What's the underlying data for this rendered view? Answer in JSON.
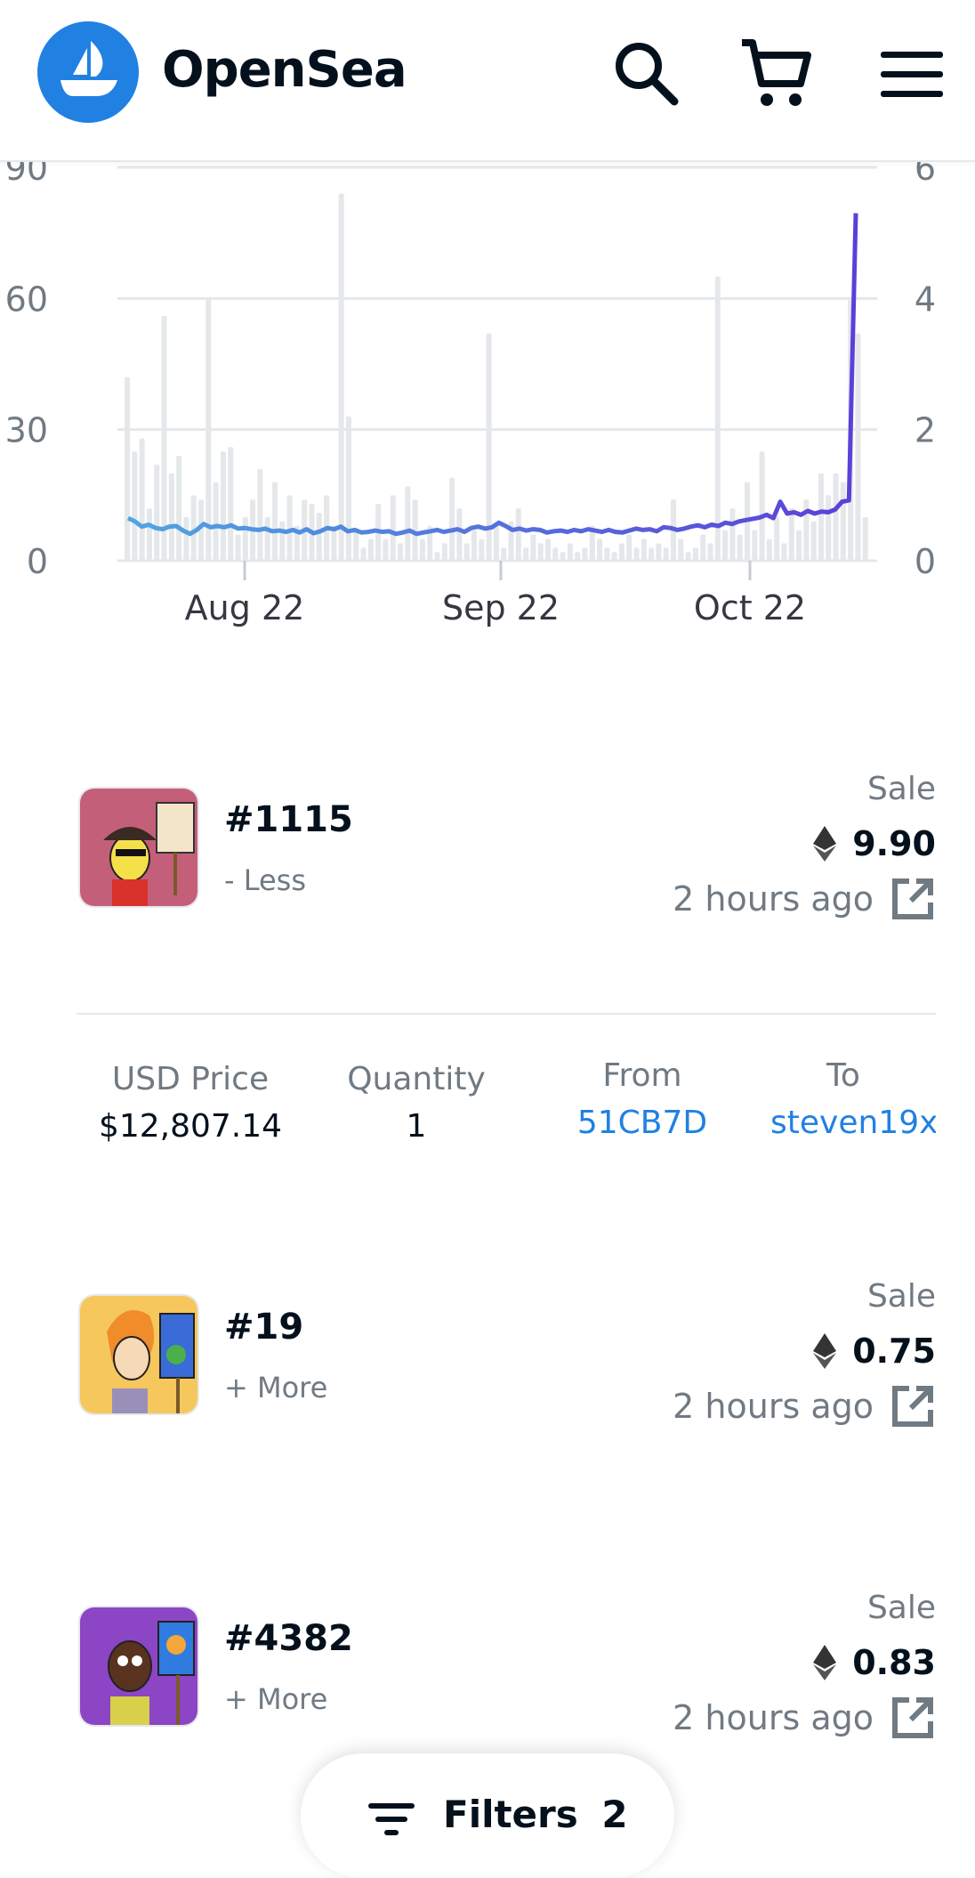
{
  "header": {
    "brand": "OpenSea",
    "icons": [
      "opensea-logo-icon",
      "search-icon",
      "cart-icon",
      "menu-icon"
    ]
  },
  "chart_data": {
    "type": "bar",
    "title": "",
    "x_ticks": [
      "Aug 22",
      "Sep 22",
      "Oct 22"
    ],
    "left_axis": {
      "ticks": [
        "0",
        "30",
        "60",
        "90"
      ],
      "ylim": [
        0,
        90
      ]
    },
    "right_axis": {
      "ticks": [
        "0",
        "2",
        "4",
        "6"
      ],
      "ylim": [
        0,
        6
      ]
    },
    "grid": true,
    "series": [
      {
        "kind": "bar",
        "axis": "left",
        "color": "#e5e8eb",
        "values": [
          42,
          25,
          28,
          12,
          22,
          56,
          20,
          24,
          10,
          15,
          14,
          60,
          18,
          25,
          26,
          6,
          10,
          14,
          21,
          10,
          18,
          9,
          15,
          8,
          14,
          13,
          11,
          15,
          8,
          84,
          33,
          7,
          3,
          5,
          13,
          5,
          15,
          4,
          17,
          14,
          5,
          8,
          2,
          4,
          19,
          12,
          4,
          7,
          5,
          52,
          8,
          3,
          9,
          12,
          3,
          6,
          4,
          5,
          3,
          2,
          4,
          2,
          3,
          8,
          5,
          3,
          2,
          4,
          6,
          3,
          5,
          3,
          4,
          3,
          14,
          5,
          2,
          3,
          6,
          4,
          65,
          7,
          12,
          6,
          18,
          7,
          25,
          5,
          10,
          4,
          12,
          7,
          14,
          9,
          20,
          15,
          20,
          18,
          60,
          52,
          10
        ]
      },
      {
        "kind": "line",
        "axis": "right",
        "color_start": "#4fa6e0",
        "color_end": "#5b3fd9",
        "values": [
          0.65,
          0.6,
          0.52,
          0.55,
          0.5,
          0.48,
          0.52,
          0.53,
          0.46,
          0.41,
          0.47,
          0.56,
          0.51,
          0.53,
          0.51,
          0.54,
          0.49,
          0.5,
          0.48,
          0.47,
          0.49,
          0.45,
          0.46,
          0.44,
          0.47,
          0.43,
          0.48,
          0.42,
          0.45,
          0.5,
          0.48,
          0.52,
          0.45,
          0.47,
          0.43,
          0.44,
          0.46,
          0.44,
          0.45,
          0.41,
          0.43,
          0.46,
          0.41,
          0.43,
          0.45,
          0.47,
          0.44,
          0.46,
          0.48,
          0.44,
          0.5,
          0.52,
          0.49,
          0.51,
          0.58,
          0.53,
          0.47,
          0.49,
          0.46,
          0.48,
          0.47,
          0.43,
          0.45,
          0.46,
          0.44,
          0.47,
          0.45,
          0.48,
          0.46,
          0.44,
          0.47,
          0.44,
          0.43,
          0.46,
          0.49,
          0.47,
          0.48,
          0.45,
          0.51,
          0.5,
          0.47,
          0.49,
          0.52,
          0.54,
          0.51,
          0.55,
          0.53,
          0.58,
          0.56,
          0.6,
          0.62,
          0.64,
          0.66,
          0.7,
          0.65,
          0.9,
          0.72,
          0.74,
          0.7,
          0.76,
          0.72,
          0.75,
          0.74,
          0.78,
          0.9,
          0.92,
          5.3
        ]
      }
    ]
  },
  "activity": [
    {
      "title": "#1115",
      "toggle": "- Less",
      "event": "Sale",
      "price": "9.90",
      "time": "2 hours ago",
      "thumb_bg": "#c45f7a"
    },
    {
      "title": "#19",
      "toggle": "+ More",
      "event": "Sale",
      "price": "0.75",
      "time": "2 hours ago",
      "thumb_bg": "#f6c75c"
    },
    {
      "title": "#4382",
      "toggle": "+ More",
      "event": "Sale",
      "price": "0.83",
      "time": "2 hours ago",
      "thumb_bg": "#8c45c4"
    }
  ],
  "details": {
    "usd_label": "USD Price",
    "usd_value": "$12,807.14",
    "qty_label": "Quantity",
    "qty_value": "1",
    "from_label": "From",
    "from_value": "51CB7D",
    "to_label": "To",
    "to_value": "steven19x"
  },
  "filters": {
    "label": "Filters",
    "count": "2"
  },
  "colors": {
    "accent": "#2081e2",
    "muted": "#707a83",
    "text": "#04111d"
  }
}
